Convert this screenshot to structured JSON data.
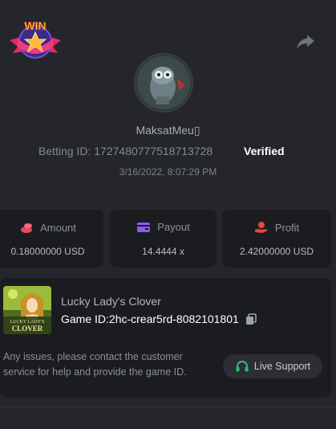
{
  "badge": {
    "text": "WIN"
  },
  "profile": {
    "username": "MaksatMeu▯",
    "betting_id_label": "Betting ID:",
    "betting_id": "1727480777518713728",
    "verified": "Verified",
    "timestamp": "3/16/2022, 8:07:29 PM"
  },
  "stats": [
    {
      "label": "Amount",
      "value": "0.18000000 USD",
      "icon": "coins-icon",
      "color": "#e8495f"
    },
    {
      "label": "Payout",
      "value": "14.4444 x",
      "icon": "wallet-icon",
      "color": "#8a5cf0"
    },
    {
      "label": "Profit",
      "value": "2.42000000 USD",
      "icon": "hand-coin-icon",
      "color": "#e5473e"
    }
  ],
  "game": {
    "name": "Lucky Lady's Clover",
    "id_label": "Game ID:",
    "id_value": "2hc-crear5rd-8082101801",
    "thumb_text_top": "LUCKY LADY'S",
    "thumb_text_bottom": "CLOVER"
  },
  "support": {
    "help_text": "Any issues, please contact the customer service for help and provide the game ID.",
    "button_label": "Live Support",
    "button_icon": "headset-icon",
    "accent": "#29c16a"
  }
}
